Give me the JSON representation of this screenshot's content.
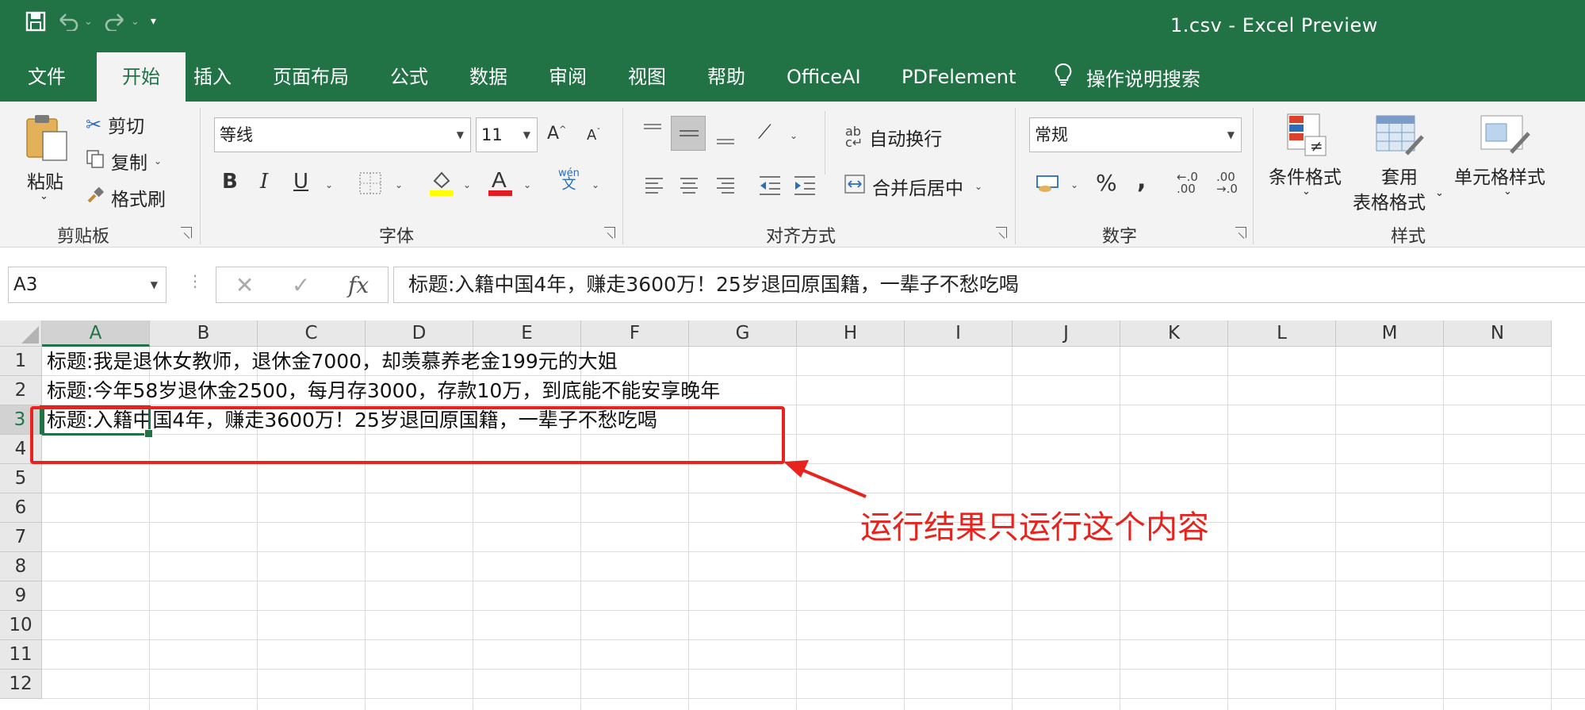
{
  "window": {
    "title": "1.csv  -  Excel Preview"
  },
  "quick_access": {
    "icons": [
      "save-icon",
      "undo-icon",
      "redo-icon",
      "customize-icon"
    ]
  },
  "ribbon_tabs": [
    {
      "label": "文件"
    },
    {
      "label": "开始",
      "active": true
    },
    {
      "label": "插入"
    },
    {
      "label": "页面布局"
    },
    {
      "label": "公式"
    },
    {
      "label": "数据"
    },
    {
      "label": "审阅"
    },
    {
      "label": "视图"
    },
    {
      "label": "帮助"
    },
    {
      "label": "OfficeAI"
    },
    {
      "label": "PDFelement"
    }
  ],
  "tell_me": {
    "label": "操作说明搜索"
  },
  "clipboard": {
    "group_label": "剪贴板",
    "paste": "粘贴",
    "cut": "剪切",
    "copy": "复制",
    "format_painter": "格式刷"
  },
  "font": {
    "group_label": "字体",
    "font_name": "等线",
    "font_size": "11",
    "bold": "B",
    "italic": "I",
    "underline": "U",
    "phonetic": "wén"
  },
  "alignment": {
    "group_label": "对齐方式",
    "wrap_text": "自动换行",
    "merge_center": "合并后居中"
  },
  "number": {
    "group_label": "数字",
    "format": "常规",
    "percent": "%",
    "comma": ",",
    "inc_decimal": ".00",
    "dec_decimal": ".0"
  },
  "styles": {
    "group_label": "样式",
    "conditional": "条件格式",
    "table_format_1": "套用",
    "table_format_2": "表格格式",
    "cell_styles": "单元格样式"
  },
  "formula_bar": {
    "name_box": "A3",
    "fx": "fx",
    "content": "标题:入籍中国4年，赚走3600万！25岁退回原国籍，一辈子不愁吃喝"
  },
  "sheet": {
    "columns": [
      "A",
      "B",
      "C",
      "D",
      "E",
      "F",
      "G",
      "H",
      "I",
      "J",
      "K",
      "L",
      "M",
      "N"
    ],
    "rows": [
      "1",
      "2",
      "3",
      "4",
      "5",
      "6",
      "7",
      "8",
      "9",
      "10",
      "11",
      "12"
    ],
    "cells": [
      "标题:我是退休女教师，退休金7000，却羡慕养老金199元的大姐",
      "标题:今年58岁退休金2500，每月存3000，存款10万，到底能不能安享晚年",
      "标题:入籍中国4年，赚走3600万！25岁退回原国籍，一辈子不愁吃喝"
    ]
  },
  "annotation": {
    "text": "运行结果只运行这个内容",
    "color": "#e8231d"
  },
  "colors": {
    "excel_green": "#217346"
  }
}
